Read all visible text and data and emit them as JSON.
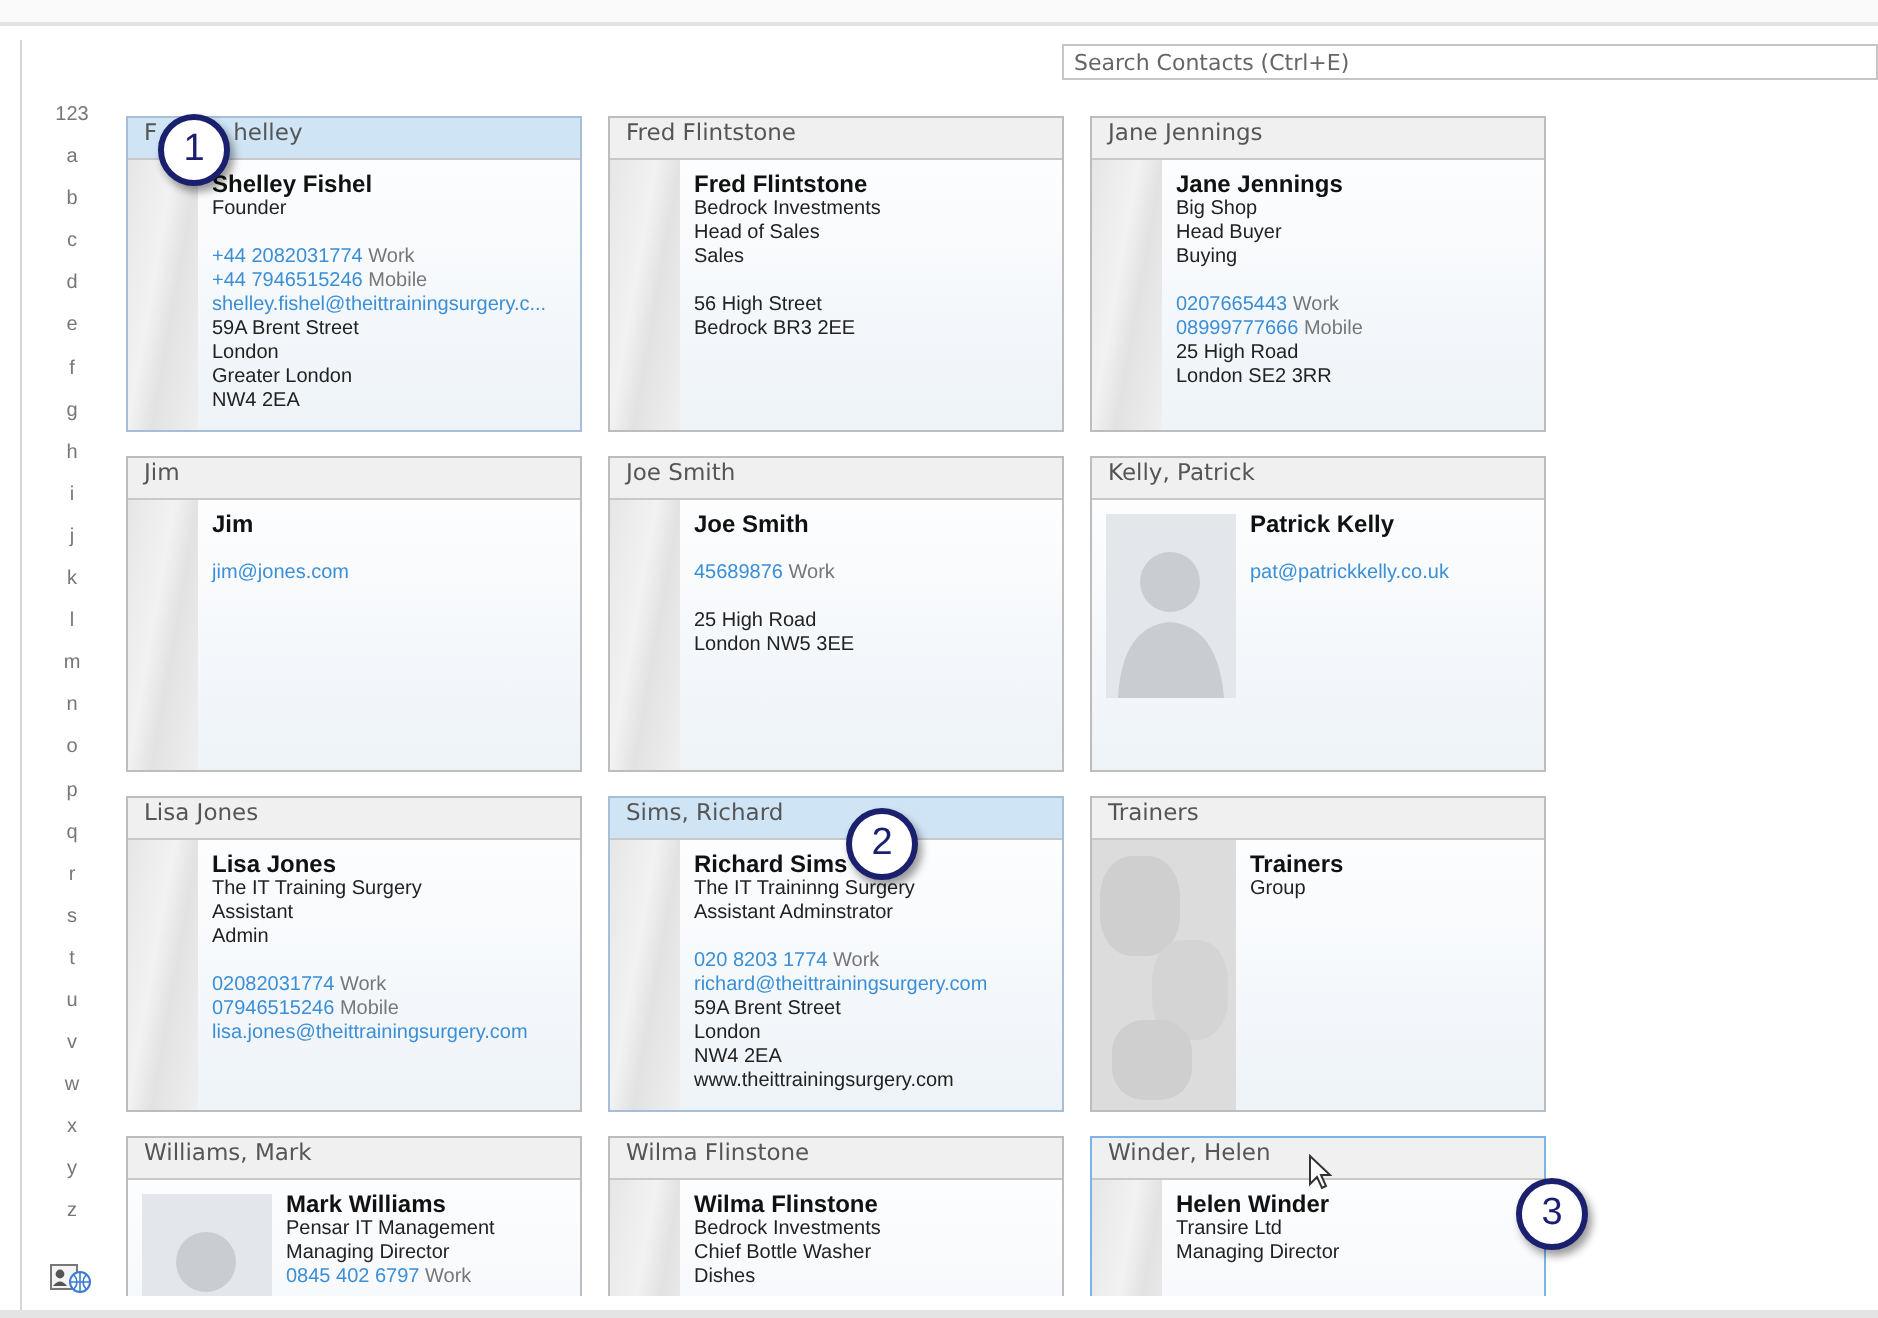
{
  "search": {
    "placeholder": "Search Contacts (Ctrl+E)"
  },
  "index": [
    "123",
    "a",
    "b",
    "c",
    "d",
    "e",
    "f",
    "g",
    "h",
    "i",
    "j",
    "k",
    "l",
    "m",
    "n",
    "o",
    "p",
    "q",
    "r",
    "s",
    "t",
    "u",
    "v",
    "w",
    "x",
    "y",
    "z"
  ],
  "cards": [
    {
      "header": [
        "F",
        "helley"
      ],
      "selected": true,
      "hovered": false,
      "kind": "stripe",
      "lines": [
        {
          "kind": "name",
          "text": "Shelley Fishel"
        },
        {
          "kind": "text",
          "text": "Founder"
        },
        {
          "kind": "gap"
        },
        {
          "kind": "phone",
          "number": "+44 2082031774",
          "label": "Work"
        },
        {
          "kind": "phone",
          "number": "+44 7946515246",
          "label": "Mobile"
        },
        {
          "kind": "email",
          "text": "shelley.fishel@theittrainingsurgery.c..."
        },
        {
          "kind": "text",
          "text": "59A Brent Street"
        },
        {
          "kind": "text",
          "text": "London"
        },
        {
          "kind": "text",
          "text": "Greater London"
        },
        {
          "kind": "text",
          "text": "NW4 2EA"
        }
      ]
    },
    {
      "header": [
        "Fred Flintstone"
      ],
      "selected": false,
      "hovered": false,
      "kind": "stripe",
      "lines": [
        {
          "kind": "name",
          "text": "Fred Flintstone"
        },
        {
          "kind": "text",
          "text": "Bedrock Investments"
        },
        {
          "kind": "text",
          "text": "Head of Sales"
        },
        {
          "kind": "text",
          "text": "Sales"
        },
        {
          "kind": "gap"
        },
        {
          "kind": "text",
          "text": "56 High Street"
        },
        {
          "kind": "text",
          "text": "Bedrock BR3 2EE"
        }
      ]
    },
    {
      "header": [
        "Jane Jennings"
      ],
      "selected": false,
      "hovered": false,
      "kind": "stripe",
      "lines": [
        {
          "kind": "name",
          "text": "Jane Jennings"
        },
        {
          "kind": "text",
          "text": "Big Shop"
        },
        {
          "kind": "text",
          "text": "Head Buyer"
        },
        {
          "kind": "text",
          "text": "Buying"
        },
        {
          "kind": "gap"
        },
        {
          "kind": "phone",
          "number": "0207665443",
          "label": "Work"
        },
        {
          "kind": "phone",
          "number": "08999777666",
          "label": "Mobile"
        },
        {
          "kind": "text",
          "text": "25 High Road"
        },
        {
          "kind": "text",
          "text": "London SE2 3RR"
        }
      ]
    },
    {
      "header": [
        "Jim"
      ],
      "selected": false,
      "hovered": false,
      "kind": "stripe",
      "lines": [
        {
          "kind": "name",
          "text": "Jim"
        },
        {
          "kind": "gap"
        },
        {
          "kind": "email",
          "text": "jim@jones.com"
        }
      ]
    },
    {
      "header": [
        "Joe Smith"
      ],
      "selected": false,
      "hovered": false,
      "kind": "stripe",
      "lines": [
        {
          "kind": "name",
          "text": "Joe Smith"
        },
        {
          "kind": "gap"
        },
        {
          "kind": "phone",
          "number": "45689876",
          "label": "Work"
        },
        {
          "kind": "gap"
        },
        {
          "kind": "text",
          "text": "25 High Road"
        },
        {
          "kind": "text",
          "text": "London NW5 3EE"
        }
      ]
    },
    {
      "header": [
        "Kelly, Patrick"
      ],
      "selected": false,
      "hovered": false,
      "kind": "photo",
      "lines": [
        {
          "kind": "name",
          "text": "Patrick Kelly"
        },
        {
          "kind": "gap"
        },
        {
          "kind": "email",
          "text": "pat@patrickkelly.co.uk"
        }
      ]
    },
    {
      "header": [
        "Lisa Jones"
      ],
      "selected": false,
      "hovered": false,
      "kind": "stripe",
      "lines": [
        {
          "kind": "name",
          "text": "Lisa Jones"
        },
        {
          "kind": "text",
          "text": "The IT Training Surgery"
        },
        {
          "kind": "text",
          "text": "Assistant"
        },
        {
          "kind": "text",
          "text": "Admin"
        },
        {
          "kind": "gap"
        },
        {
          "kind": "phone",
          "number": "02082031774",
          "label": "Work"
        },
        {
          "kind": "phone",
          "number": "07946515246",
          "label": "Mobile"
        },
        {
          "kind": "email",
          "text": "lisa.jones@theittrainingsurgery.com"
        }
      ]
    },
    {
      "header": [
        "Sims, Richard"
      ],
      "selected": true,
      "hovered": false,
      "kind": "stripe",
      "lines": [
        {
          "kind": "name",
          "text": "Richard Sims"
        },
        {
          "kind": "text",
          "text": "The IT Traininng Surgery"
        },
        {
          "kind": "text",
          "text": "Assistant Adminstrator"
        },
        {
          "kind": "gap"
        },
        {
          "kind": "phone",
          "number": "020 8203 1774",
          "label": "Work"
        },
        {
          "kind": "email",
          "text": "richard@theittrainingsurgery.com"
        },
        {
          "kind": "text",
          "text": "59A Brent Street"
        },
        {
          "kind": "text",
          "text": "London"
        },
        {
          "kind": "text",
          "text": "NW4 2EA"
        },
        {
          "kind": "text",
          "text": "www.theittrainingsurgery.com"
        }
      ]
    },
    {
      "header": [
        "Trainers"
      ],
      "selected": false,
      "hovered": false,
      "kind": "group",
      "lines": [
        {
          "kind": "name",
          "text": "Trainers"
        },
        {
          "kind": "text",
          "text": "Group"
        }
      ]
    },
    {
      "header": [
        "Williams, Mark"
      ],
      "selected": false,
      "hovered": false,
      "kind": "photo",
      "lines": [
        {
          "kind": "name",
          "text": "Mark Williams"
        },
        {
          "kind": "text",
          "text": "Pensar IT Management"
        },
        {
          "kind": "text",
          "text": "Managing Director"
        },
        {
          "kind": "phone",
          "number": "0845 402 6797",
          "label": "Work"
        }
      ]
    },
    {
      "header": [
        "Wilma Flinstone"
      ],
      "selected": false,
      "hovered": false,
      "kind": "stripe",
      "lines": [
        {
          "kind": "name",
          "text": "Wilma Flinstone"
        },
        {
          "kind": "text",
          "text": "Bedrock Investments"
        },
        {
          "kind": "text",
          "text": "Chief Bottle Washer"
        },
        {
          "kind": "text",
          "text": "Dishes"
        }
      ]
    },
    {
      "header": [
        "Winder, Helen"
      ],
      "selected": false,
      "hovered": true,
      "kind": "stripe",
      "lines": [
        {
          "kind": "name",
          "text": "Helen Winder"
        },
        {
          "kind": "text",
          "text": "Transire Ltd"
        },
        {
          "kind": "text",
          "text": "Managing Director"
        }
      ]
    }
  ],
  "callouts": [
    "1",
    "2",
    "3"
  ]
}
